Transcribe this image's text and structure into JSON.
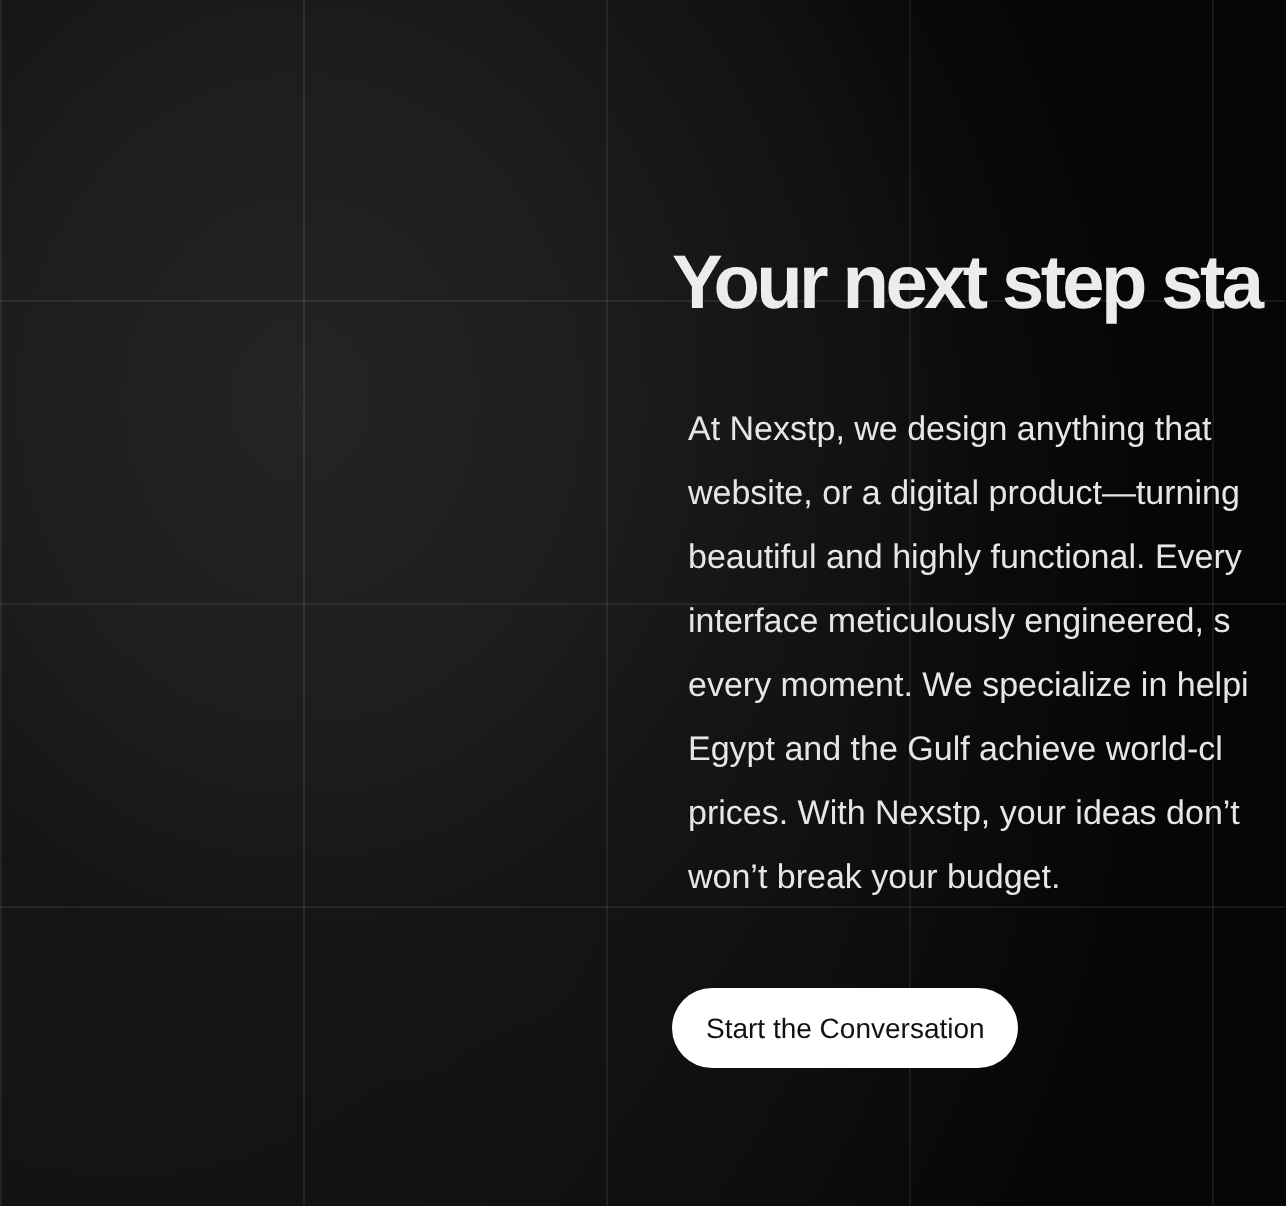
{
  "hero": {
    "heading": "Your next step sta",
    "body_lines": [
      "At Nexstp, we design anything that",
      "website, or a digital product—turning",
      "beautiful and highly functional. Every",
      "interface meticulously engineered, s",
      "every moment. We specialize in helpi",
      "Egypt and the Gulf achieve world-cl",
      "prices. With Nexstp, your ideas don’t",
      "won’t break your budget."
    ],
    "button": "Start the Conversation"
  }
}
